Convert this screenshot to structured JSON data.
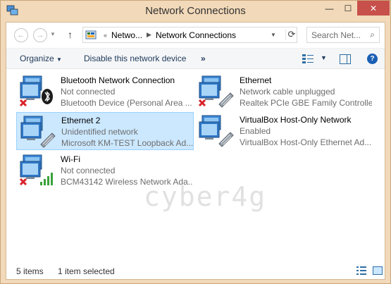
{
  "window": {
    "title": "Network Connections",
    "buttons": {
      "minimize": "—",
      "maximize": "☐",
      "close": "✕"
    }
  },
  "addressbar": {
    "overflow": "«",
    "crumbs": [
      "Netwo...",
      "Network Connections"
    ],
    "search_placeholder": "Search Net..."
  },
  "toolbar": {
    "organize_label": "Organize",
    "disable_label": "Disable this network device",
    "more_label": "»"
  },
  "items": [
    {
      "name": "Bluetooth Network Connection",
      "status": "Not connected",
      "device": "Bluetooth Device (Personal Area ...",
      "icon": "bluetooth-network-icon",
      "badge": "disconnected-x",
      "selected": false
    },
    {
      "name": "Ethernet",
      "status": "Network cable unplugged",
      "device": "Realtek PCIe GBE Family Controller",
      "icon": "ethernet-network-icon",
      "badge": "disconnected-x",
      "selected": false
    },
    {
      "name": "Ethernet 2",
      "status": "Unidentified network",
      "device": "Microsoft KM-TEST Loopback Ad...",
      "icon": "ethernet-network-icon",
      "badge": "none",
      "selected": true
    },
    {
      "name": "VirtualBox Host-Only Network",
      "status": "Enabled",
      "device": "VirtualBox Host-Only Ethernet Ad...",
      "icon": "ethernet-network-icon",
      "badge": "none",
      "selected": false
    },
    {
      "name": "Wi-Fi",
      "status": "Not connected",
      "device": "BCM43142 Wireless Network Ada...",
      "icon": "wifi-network-icon",
      "badge": "disconnected-x",
      "selected": false
    }
  ],
  "watermark": "cyber4g",
  "status": {
    "item_count": "5 items",
    "selected_count": "1 item selected"
  },
  "colors": {
    "window_frame": "#f2d9b9",
    "close_button": "#c7504b",
    "selection_bg": "#cce8ff",
    "selection_border": "#99d1ff",
    "link_text": "#1e395b"
  }
}
